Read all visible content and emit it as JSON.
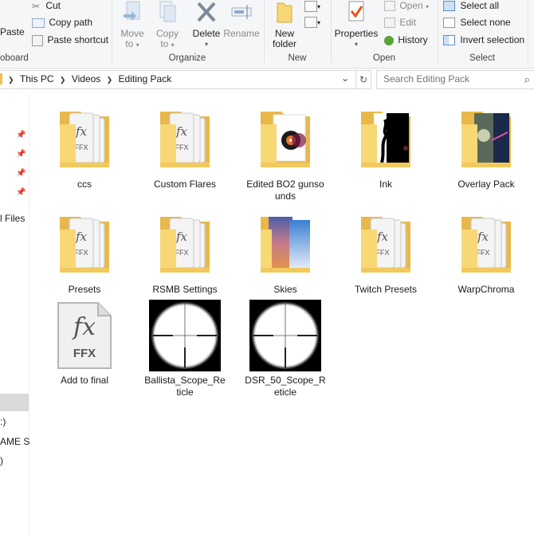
{
  "ribbon": {
    "clipboard": {
      "paste": "Paste",
      "cut": "Cut",
      "copy_path": "Copy path",
      "paste_shortcut": "Paste shortcut",
      "group_label": "oboard"
    },
    "organize": {
      "move_to": "Move",
      "move_to2": "to",
      "copy_to": "Copy",
      "copy_to2": "to",
      "delete": "Delete",
      "rename": "Rename",
      "group_label": "Organize"
    },
    "new": {
      "new_folder": "New",
      "new_folder2": "folder",
      "group_label": "New"
    },
    "open": {
      "properties": "Properties",
      "open": "Open",
      "edit": "Edit",
      "history": "History",
      "group_label": "Open"
    },
    "select": {
      "select_all": "Select all",
      "select_none": "Select none",
      "invert": "Invert selection",
      "group_label": "Select"
    }
  },
  "address": {
    "crumbs": [
      "This PC",
      "Videos",
      "Editing Pack"
    ],
    "search_placeholder": "Search Editing Pack"
  },
  "nav_labels": [
    "l Files",
    ":)",
    "AME S",
    ")"
  ],
  "items": [
    {
      "name": "ccs",
      "type": "ffx-folder"
    },
    {
      "name": "Custom Flares",
      "type": "ffx-folder"
    },
    {
      "name": "Edited BO2 gunsounds",
      "type": "media-folder"
    },
    {
      "name": "Ink",
      "type": "ink-folder"
    },
    {
      "name": "Overlay Pack",
      "type": "overlay-folder"
    },
    {
      "name": "Presets",
      "type": "ffx-folder"
    },
    {
      "name": "RSMB Settings",
      "type": "ffx-folder"
    },
    {
      "name": "Skies",
      "type": "sky-folder"
    },
    {
      "name": "Twitch Presets",
      "type": "ffx-folder"
    },
    {
      "name": "WarpChroma",
      "type": "ffx-folder"
    },
    {
      "name": "Add to final",
      "type": "ffx-file"
    },
    {
      "name": "Ballista_Scope_Reticle",
      "type": "scope"
    },
    {
      "name": "DSR_50_Scope_Reticle",
      "type": "scope"
    }
  ],
  "ffx_icon": {
    "fx": "fx",
    "ffx": "FFX"
  },
  "colors": {
    "folder": "#f8d775",
    "folder_dark": "#e8b84a",
    "accent": "#1979ca"
  }
}
